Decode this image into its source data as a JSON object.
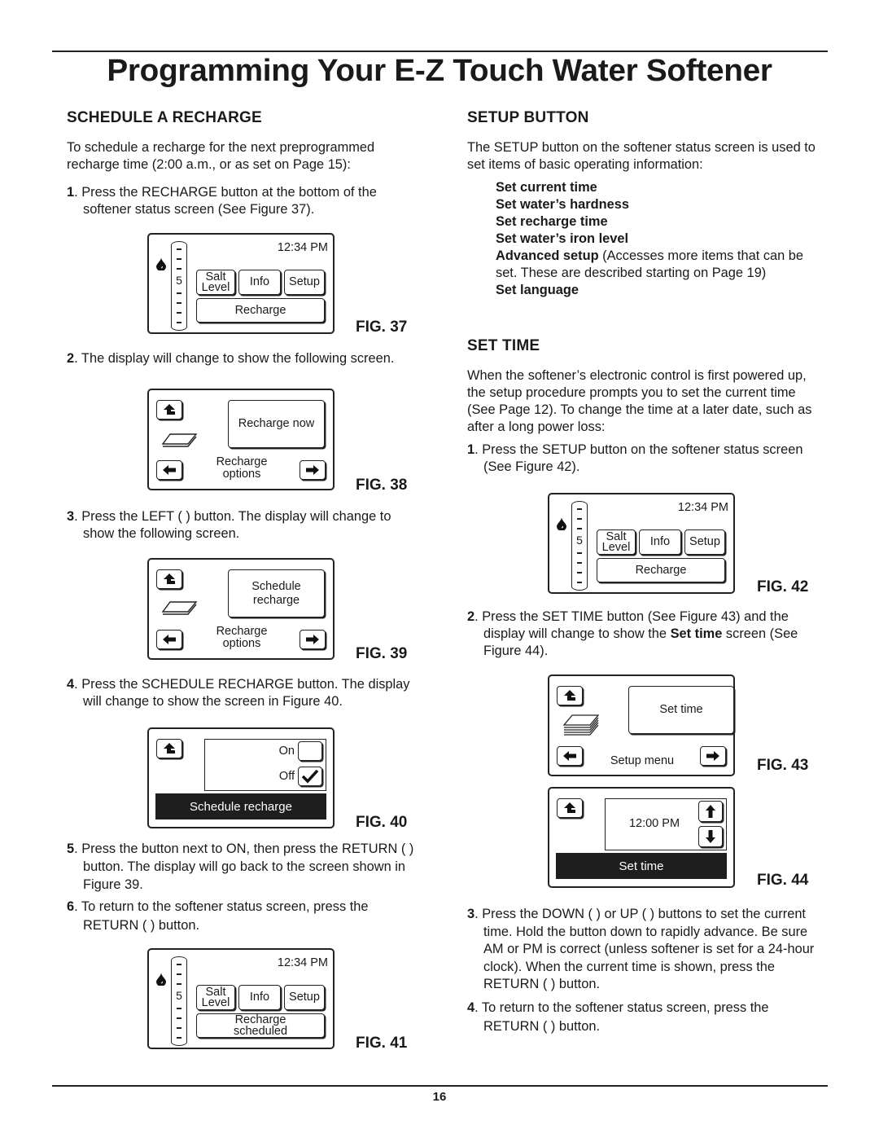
{
  "page": {
    "title": "Programming Your E-Z Touch Water Softener",
    "page_number": "16"
  },
  "left": {
    "heading": "SCHEDULE A RECHARGE",
    "intro": "To schedule a recharge for the next preprogrammed recharge time (2:00 a.m., or as set on Page 15):",
    "steps": [
      {
        "num": "1",
        "text": ". Press the RECHARGE button at the bottom of the softener status screen (See Figure 37)."
      },
      {
        "num": "2",
        "text": ". The display will change to show the following screen."
      },
      {
        "num": "3",
        "text": ". Press the LEFT (    ) button.  The display will change to show the following screen."
      },
      {
        "num": "4",
        "text": ". Press the SCHEDULE RECHARGE button.  The display will change to show the screen in Figure 40."
      },
      {
        "num": "5",
        "text": ". Press the button next to ON, then press the RETURN (    ) button.  The display will go back to the screen shown in Figure 39."
      },
      {
        "num": "6",
        "text": ". To return to the softener status screen, press the RETURN (    ) button."
      }
    ]
  },
  "right": {
    "setup_heading": "SETUP BUTTON",
    "setup_intro": "The SETUP button on the softener status screen is used to set items of basic operating information:",
    "setup_items": [
      "Set current time",
      "Set water’s hardness",
      "Set recharge time",
      "Set water’s iron level"
    ],
    "advanced_label": "Advanced setup",
    "advanced_desc": " (Accesses more items that can be set.  These are described starting on Page 19)",
    "language_label": "Set language",
    "settime_heading": "SET TIME",
    "settime_intro": "When the softener’s electronic control is first powered up, the setup procedure prompts you to set the current time (See Page 12).  To change the time at a later date, such as after a long power loss:",
    "steps": [
      {
        "num": "1",
        "text": ". Press the SETUP button on the softener status screen (See Figure 42)."
      },
      {
        "num": "2",
        "text_a": ". Press the SET TIME button (See Figure 43) and the display will change to show the ",
        "bold": "Set time",
        "text_b": " screen (See Figure 44)."
      },
      {
        "num": "3",
        "text": ". Press the DOWN (    ) or UP (    ) buttons to set the current time.  Hold the button down to rapidly advance.  Be sure AM or PM is correct (unless softener is set for a 24-hour clock).  When the current time is shown, press the RETURN (    ) button."
      },
      {
        "num": "4",
        "text": ". To return to the softener status screen, press the RETURN (    ) button."
      }
    ]
  },
  "figures": {
    "fig37": {
      "label": "FIG. 37",
      "time": "12:34 PM",
      "salt_level": "5",
      "salt_btn_1": "Salt",
      "salt_btn_2": "Level",
      "info_btn": "Info",
      "setup_btn": "Setup",
      "recharge_btn": "Recharge"
    },
    "fig38": {
      "label": "FIG. 38",
      "main_btn": "Recharge now",
      "menu_1": "Recharge",
      "menu_2": "options"
    },
    "fig39": {
      "label": "FIG. 39",
      "main_btn_1": "Schedule",
      "main_btn_2": "recharge",
      "menu_1": "Recharge",
      "menu_2": "options"
    },
    "fig40": {
      "label": "FIG. 40",
      "on_label": "On",
      "off_label": "Off",
      "on_checked": false,
      "off_checked": true,
      "bar": "Schedule recharge"
    },
    "fig41": {
      "label": "FIG. 41",
      "time": "12:34 PM",
      "salt_level": "5",
      "salt_btn_1": "Salt",
      "salt_btn_2": "Level",
      "info_btn": "Info",
      "setup_btn": "Setup",
      "recharge_btn_1": "Recharge",
      "recharge_btn_2": "scheduled"
    },
    "fig42": {
      "label": "FIG. 42",
      "time": "12:34 PM",
      "salt_level": "5",
      "salt_btn_1": "Salt",
      "salt_btn_2": "Level",
      "info_btn": "Info",
      "setup_btn": "Setup",
      "recharge_btn": "Recharge"
    },
    "fig43": {
      "label": "FIG. 43",
      "main_btn": "Set time",
      "menu": "Setup menu"
    },
    "fig44": {
      "label": "FIG. 44",
      "time_value": "12:00 PM",
      "bar": "Set time"
    }
  }
}
